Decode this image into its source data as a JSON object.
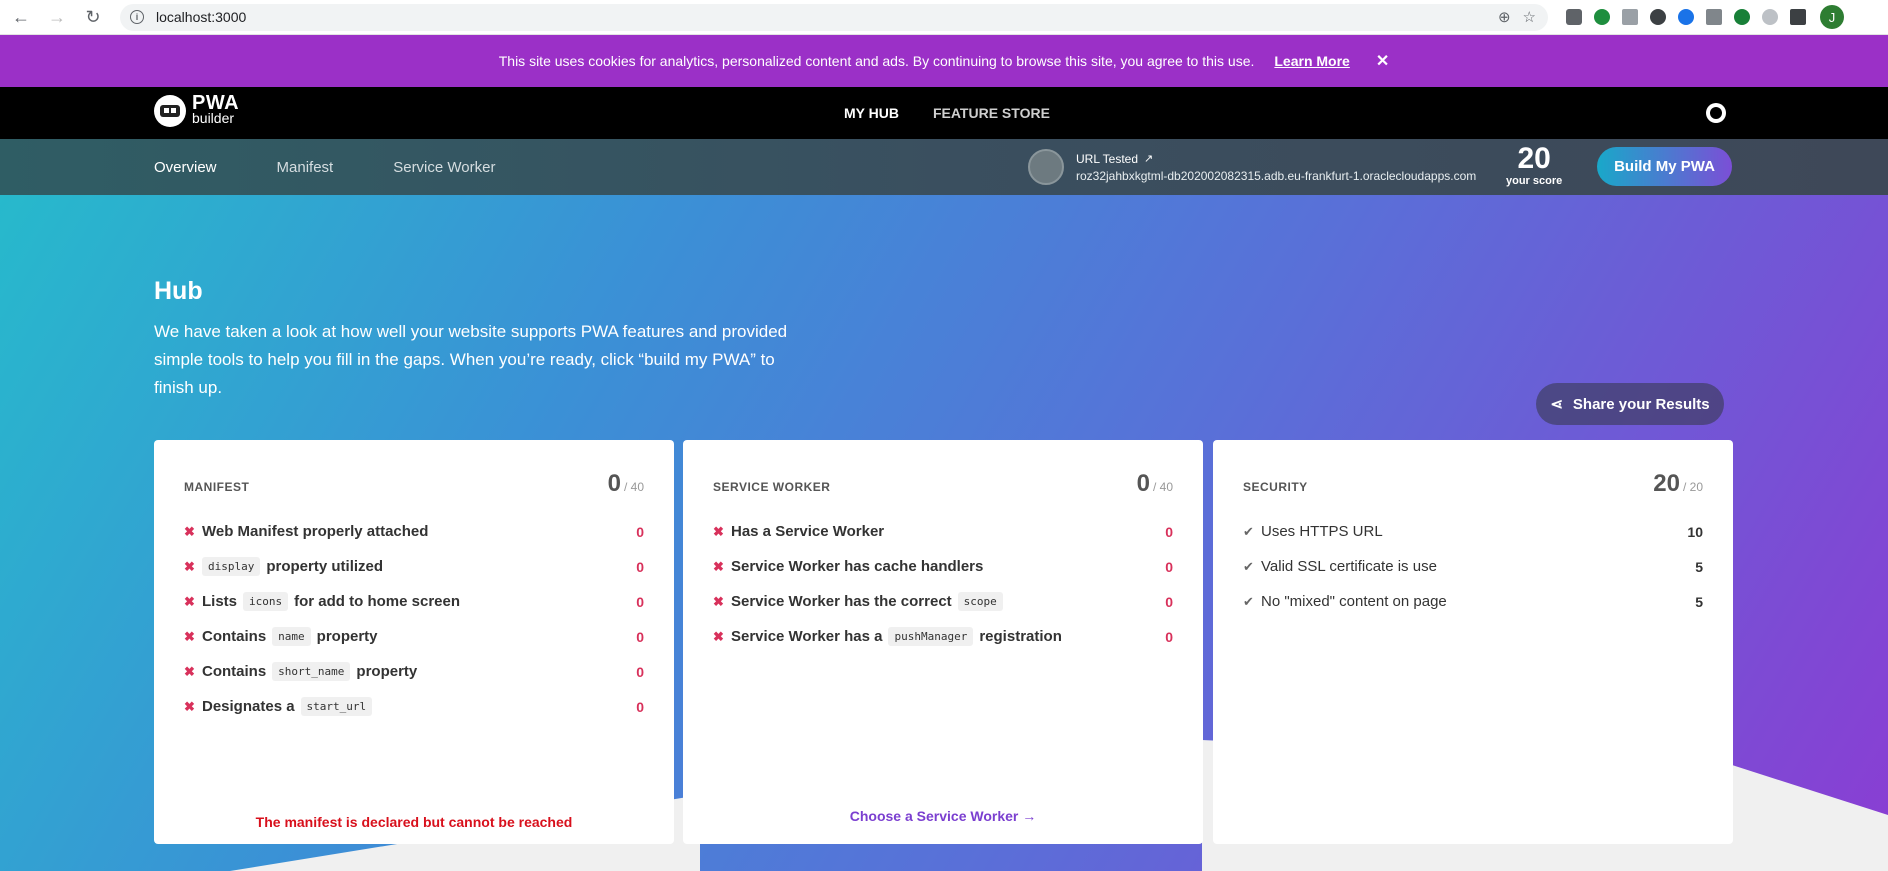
{
  "browser": {
    "url": "localhost:3000",
    "avatar_letter": "J"
  },
  "cookie": {
    "message": "This site uses cookies for analytics, personalized content and ads. By continuing to browse this site, you agree to this use.",
    "learn_more": "Learn More",
    "close": "✕"
  },
  "nav": {
    "logo_top": "PWA",
    "logo_bottom": "builder",
    "links": [
      "MY HUB",
      "FEATURE STORE"
    ]
  },
  "subnav": {
    "tabs": [
      "Overview",
      "Manifest",
      "Service Worker"
    ],
    "url_label": "URL Tested",
    "url_value": "roz32jahbxkgtml-db202002082315.adb.eu-frankfurt-1.oraclecloudapps.com",
    "score": "20",
    "score_label": "your score",
    "build_button": "Build My PWA"
  },
  "hero": {
    "title": "Hub",
    "description": "We have taken a look at how well your website supports PWA features and provided simple tools to help you fill in the gaps. When you’re ready, click “build my PWA” to finish up.",
    "share_button": "Share your Results"
  },
  "manifest": {
    "title": "MANIFEST",
    "score": "0",
    "max": "/ 40",
    "rows": [
      {
        "pre": "Web Manifest properly attached",
        "code": "",
        "post": "",
        "pts": "0"
      },
      {
        "pre": "",
        "code": "display",
        "post": "property utilized",
        "pts": "0"
      },
      {
        "pre": "Lists",
        "code": "icons",
        "post": "for add to home screen",
        "pts": "0"
      },
      {
        "pre": "Contains",
        "code": "name",
        "post": "property",
        "pts": "0"
      },
      {
        "pre": "Contains",
        "code": "short_name",
        "post": "property",
        "pts": "0"
      },
      {
        "pre": "Designates a",
        "code": "start_url",
        "post": "",
        "pts": "0"
      }
    ],
    "footer": "The manifest is declared but cannot be reached"
  },
  "service_worker": {
    "title": "SERVICE WORKER",
    "score": "0",
    "max": "/ 40",
    "rows": [
      {
        "pre": "Has a Service Worker",
        "code": "",
        "post": "",
        "pts": "0"
      },
      {
        "pre": "Service Worker has cache handlers",
        "code": "",
        "post": "",
        "pts": "0"
      },
      {
        "pre": "Service Worker has the correct",
        "code": "scope",
        "post": "",
        "pts": "0"
      },
      {
        "pre": "Service Worker has a",
        "code": "pushManager",
        "post": "registration",
        "pts": "0"
      }
    ],
    "footer": "Choose a Service Worker →"
  },
  "security": {
    "title": "SECURITY",
    "score": "20",
    "max": "/ 20",
    "rows": [
      {
        "label": "Uses HTTPS URL",
        "pts": "10"
      },
      {
        "label": "Valid SSL certificate is use",
        "pts": "5"
      },
      {
        "label": "No \"mixed\" content on page",
        "pts": "5"
      }
    ]
  },
  "colors": {
    "banner": "#9b30c7",
    "fail": "#d8315b",
    "accent": "#7b3fd0"
  }
}
